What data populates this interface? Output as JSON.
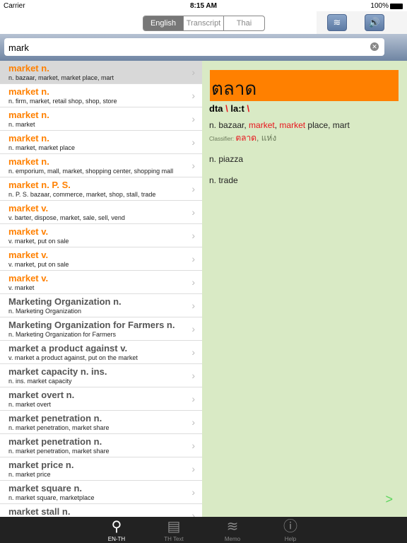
{
  "status": {
    "carrier": "Carrier",
    "time": "8:15 AM",
    "battery": "100%"
  },
  "toolbar": {
    "segments": [
      "English",
      "Transcript",
      "Thai"
    ],
    "selected": "English"
  },
  "search": {
    "value": "mark"
  },
  "list": [
    {
      "title": "market n.",
      "desc": "n. bazaar, market, market place, mart",
      "highlight": true
    },
    {
      "title": "market n.",
      "desc": "n. firm, market, retail shop, shop, store",
      "highlight": true
    },
    {
      "title": "market n.",
      "desc": " n. market",
      "highlight": true
    },
    {
      "title": "market n.",
      "desc": "n. market, market place",
      "highlight": true
    },
    {
      "title": "market n.",
      "desc": "n. emporium, mall, market, shopping center, shopping mall",
      "highlight": true
    },
    {
      "title": "market n. P. S.",
      "desc": "n. P. S. bazaar, commerce, market, shop, stall, trade",
      "highlight": true
    },
    {
      "title": "market v.",
      "desc": "v. barter, dispose, market, sale, sell, vend",
      "highlight": true
    },
    {
      "title": "market v.",
      "desc": "v. market, put on sale",
      "highlight": true
    },
    {
      "title": "market v.",
      "desc": "v. market, put on sale",
      "highlight": true
    },
    {
      "title": "market v.",
      "desc": "v. market",
      "highlight": true
    },
    {
      "title": "Marketing Organization n.",
      "desc": "n. Marketing Organization",
      "highlight": false
    },
    {
      "title": "Marketing Organization for Farmers n.",
      "desc": "n. Marketing Organization for Farmers",
      "highlight": false
    },
    {
      "title": "market a product against v.",
      "desc": "v. market a product against, put on the market",
      "highlight": false
    },
    {
      "title": "market capacity n. ins.",
      "desc": "n. ins. market capacity",
      "highlight": false
    },
    {
      "title": "market overt n.",
      "desc": "n. market overt",
      "highlight": false
    },
    {
      "title": "market penetration n.",
      "desc": "n. market penetration, market share",
      "highlight": false
    },
    {
      "title": "market penetration n.",
      "desc": "n. market penetration, market share",
      "highlight": false
    },
    {
      "title": "market price n.",
      "desc": "n. market price",
      "highlight": false
    },
    {
      "title": "market square n.",
      "desc": "n. market square, marketplace",
      "highlight": false
    },
    {
      "title": "market stall n.",
      "desc": "",
      "highlight": false
    }
  ],
  "detail": {
    "headword": "ตลาด",
    "pron": "dta",
    "pron2": "la:t",
    "sep": "\\",
    "sense1": {
      "a": "n. bazaar, ",
      "b": "market",
      ", ": ", ",
      "c": "market",
      "d": " place, mart"
    },
    "classifier_label": "Classifier: ",
    "classifier_red": "ตลาด",
    "classifier_rest": ", แห่ง",
    "sense2": "n. piazza",
    "sense3": "n. trade",
    "next": ">"
  },
  "tabs": [
    {
      "label": "EN-TH",
      "icon": "search-icon"
    },
    {
      "label": "TH Text",
      "icon": "document-icon"
    },
    {
      "label": "Memo",
      "icon": "layers-icon"
    },
    {
      "label": "Help",
      "icon": "info-icon"
    }
  ],
  "colors": {
    "accent": "#ff8000",
    "detail_bg": "#d9eac5",
    "highlight_red": "#e8141c"
  }
}
